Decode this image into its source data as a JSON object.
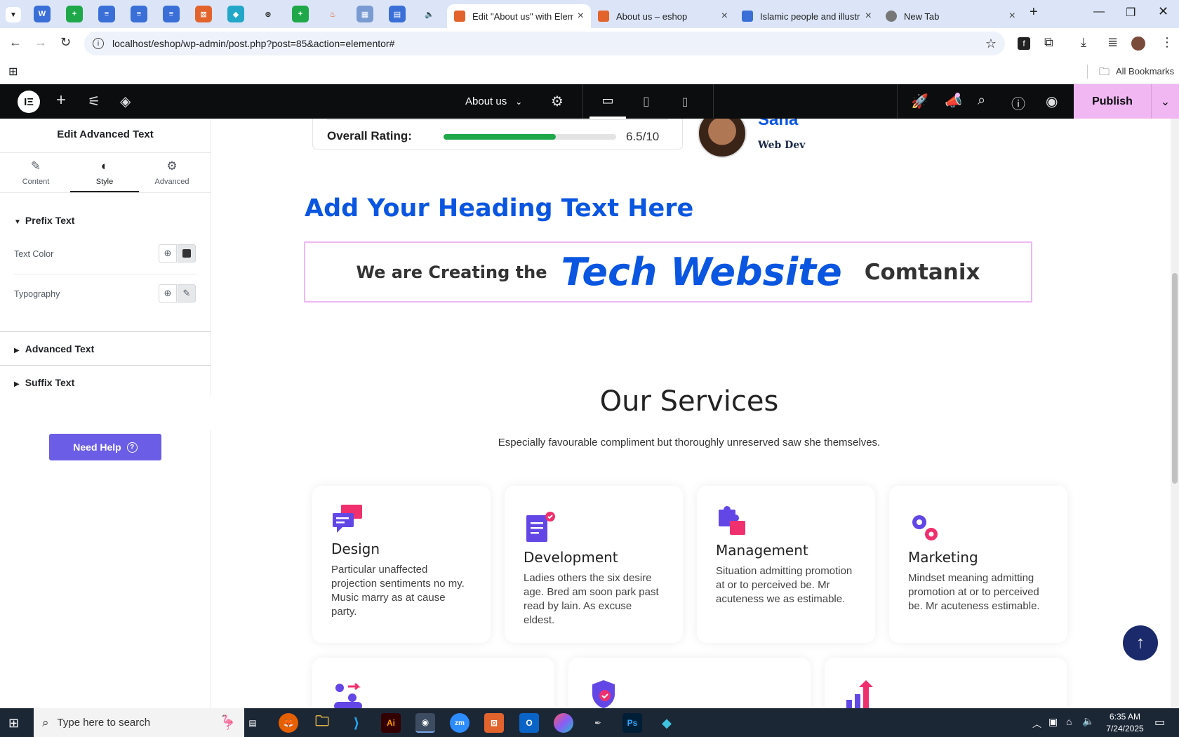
{
  "browser": {
    "tabs": [
      {
        "title": "Edit \"About us\" with Elem",
        "active": true,
        "color": "#e2642c"
      },
      {
        "title": "About us – eshop",
        "active": false,
        "color": "#e2642c"
      },
      {
        "title": "Islamic people and illustr",
        "active": false,
        "color": "#3b6fd8"
      },
      {
        "title": "New Tab",
        "active": false,
        "color": "#777777"
      }
    ],
    "url": "localhost/eshop/wp-admin/post.php?post=85&action=elementor#",
    "bookmarks_label": "All Bookmarks"
  },
  "editor": {
    "page_name": "About us",
    "publish_label": "Publish"
  },
  "panel": {
    "title": "Edit Advanced Text",
    "tabs": [
      "Content",
      "Style",
      "Advanced"
    ],
    "sections": {
      "prefix": "Prefix Text",
      "text_color": "Text Color",
      "typography": "Typography",
      "advanced": "Advanced Text",
      "suffix": "Suffix Text"
    },
    "need_help": "Need Help"
  },
  "canvas": {
    "rating_label": "Overall Rating:",
    "rating_value": "6.5/10",
    "rating_fraction": 0.65,
    "profile_name": "Sana",
    "profile_role": "Web Dev",
    "heading": "Add Your Heading Text Here",
    "advanced_text": {
      "prefix": "We are Creating the",
      "highlight": "Tech Website",
      "suffix": "Comtanix"
    },
    "services_title": "Our Services",
    "services_subtitle": "Especially favourable compliment but thoroughly unreserved saw she themselves.",
    "services": [
      {
        "title": "Design",
        "desc": "Particular unaffected projection sentiments no my. Music marry as at cause party."
      },
      {
        "title": "Development",
        "desc": "Ladies others the six desire age. Bred am soon park past read by lain. As excuse eldest."
      },
      {
        "title": "Management",
        "desc": "Situation admitting promotion at or to perceived be. Mr acuteness we as estimable."
      },
      {
        "title": "Marketing",
        "desc": "Mindset meaning admitting promotion at or to perceived be. Mr acuteness estimable."
      }
    ]
  },
  "taskbar": {
    "search_placeholder": "Type here to search",
    "time": "6:35 AM",
    "date": "7/24/2025"
  },
  "colors": {
    "accent": "#0a56e0",
    "elementor_pink": "#f0b7f3",
    "rating_green": "#1fa84a",
    "help_purple": "#6b5de6"
  }
}
